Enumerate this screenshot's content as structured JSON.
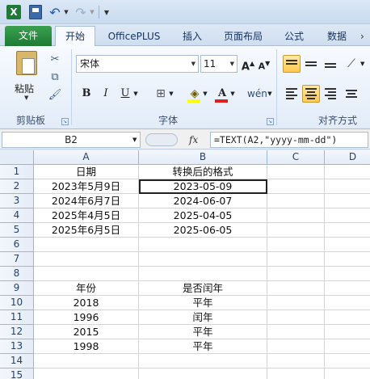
{
  "quick_access": {
    "app_icon": "excel-icon",
    "app_letter": "X",
    "buttons": [
      "save-icon",
      "undo-icon",
      "redo-icon",
      "customize-icon"
    ]
  },
  "tabs": [
    {
      "id": "tab-file",
      "label": "文件"
    },
    {
      "id": "tab-home",
      "label": "开始"
    },
    {
      "id": "tab-officeplus",
      "label": "OfficePLUS"
    },
    {
      "id": "tab-insert",
      "label": "插入"
    },
    {
      "id": "tab-page-layout",
      "label": "页面布局"
    },
    {
      "id": "tab-formulas",
      "label": "公式"
    },
    {
      "id": "tab-data",
      "label": "数据"
    }
  ],
  "ribbon": {
    "clipboard": {
      "paste_label": "粘贴",
      "group_label": "剪贴板"
    },
    "font": {
      "font_name": "宋体",
      "font_size": "11",
      "bold": "B",
      "italic": "I",
      "underline": "U",
      "font_color_letter": "A",
      "phonetic_glyph": "wén",
      "grow": "A",
      "shrink": "A",
      "group_label": "字体"
    },
    "alignment": {
      "group_label": "对齐方式"
    }
  },
  "formula_bar": {
    "name_box": "B2",
    "fx": "fx",
    "formula": "=TEXT(A2,\"yyyy-mm-dd\")"
  },
  "sheet": {
    "columns": [
      "A",
      "B",
      "C",
      "D"
    ],
    "rows": [
      "1",
      "2",
      "3",
      "4",
      "5",
      "6",
      "7",
      "8",
      "9",
      "10",
      "11",
      "12",
      "13",
      "14",
      "15"
    ],
    "cells": [
      [
        "日期",
        "转换后的格式",
        "",
        ""
      ],
      [
        "2023年5月9日",
        "2023-05-09",
        "",
        ""
      ],
      [
        "2024年6月7日",
        "2024-06-07",
        "",
        ""
      ],
      [
        "2025年4月5日",
        "2025-04-05",
        "",
        ""
      ],
      [
        "2025年6月5日",
        "2025-06-05",
        "",
        ""
      ],
      [
        "",
        "",
        "",
        ""
      ],
      [
        "",
        "",
        "",
        ""
      ],
      [
        "",
        "",
        "",
        ""
      ],
      [
        "年份",
        "是否闰年",
        "",
        ""
      ],
      [
        "2018",
        "平年",
        "",
        ""
      ],
      [
        "1996",
        "闰年",
        "",
        ""
      ],
      [
        "2015",
        "平年",
        "",
        ""
      ],
      [
        "1998",
        "平年",
        "",
        ""
      ],
      [
        "",
        "",
        "",
        ""
      ],
      [
        "",
        "",
        "",
        ""
      ]
    ],
    "active_cell": "B2"
  },
  "colors": {
    "file_tab": "#1d7a33",
    "fill_color": "#ffff00",
    "font_color": "#e0201a",
    "active_align": "#ffc94d"
  }
}
